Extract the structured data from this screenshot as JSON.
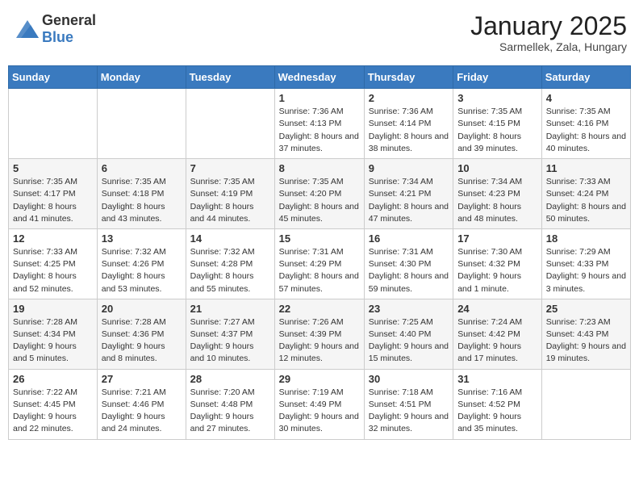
{
  "header": {
    "logo_general": "General",
    "logo_blue": "Blue",
    "month_title": "January 2025",
    "location": "Sarmellek, Zala, Hungary"
  },
  "weekdays": [
    "Sunday",
    "Monday",
    "Tuesday",
    "Wednesday",
    "Thursday",
    "Friday",
    "Saturday"
  ],
  "weeks": [
    [
      {
        "day": "",
        "sunrise": "",
        "sunset": "",
        "daylight": ""
      },
      {
        "day": "",
        "sunrise": "",
        "sunset": "",
        "daylight": ""
      },
      {
        "day": "",
        "sunrise": "",
        "sunset": "",
        "daylight": ""
      },
      {
        "day": "1",
        "sunrise": "Sunrise: 7:36 AM",
        "sunset": "Sunset: 4:13 PM",
        "daylight": "Daylight: 8 hours and 37 minutes."
      },
      {
        "day": "2",
        "sunrise": "Sunrise: 7:36 AM",
        "sunset": "Sunset: 4:14 PM",
        "daylight": "Daylight: 8 hours and 38 minutes."
      },
      {
        "day": "3",
        "sunrise": "Sunrise: 7:35 AM",
        "sunset": "Sunset: 4:15 PM",
        "daylight": "Daylight: 8 hours and 39 minutes."
      },
      {
        "day": "4",
        "sunrise": "Sunrise: 7:35 AM",
        "sunset": "Sunset: 4:16 PM",
        "daylight": "Daylight: 8 hours and 40 minutes."
      }
    ],
    [
      {
        "day": "5",
        "sunrise": "Sunrise: 7:35 AM",
        "sunset": "Sunset: 4:17 PM",
        "daylight": "Daylight: 8 hours and 41 minutes."
      },
      {
        "day": "6",
        "sunrise": "Sunrise: 7:35 AM",
        "sunset": "Sunset: 4:18 PM",
        "daylight": "Daylight: 8 hours and 43 minutes."
      },
      {
        "day": "7",
        "sunrise": "Sunrise: 7:35 AM",
        "sunset": "Sunset: 4:19 PM",
        "daylight": "Daylight: 8 hours and 44 minutes."
      },
      {
        "day": "8",
        "sunrise": "Sunrise: 7:35 AM",
        "sunset": "Sunset: 4:20 PM",
        "daylight": "Daylight: 8 hours and 45 minutes."
      },
      {
        "day": "9",
        "sunrise": "Sunrise: 7:34 AM",
        "sunset": "Sunset: 4:21 PM",
        "daylight": "Daylight: 8 hours and 47 minutes."
      },
      {
        "day": "10",
        "sunrise": "Sunrise: 7:34 AM",
        "sunset": "Sunset: 4:23 PM",
        "daylight": "Daylight: 8 hours and 48 minutes."
      },
      {
        "day": "11",
        "sunrise": "Sunrise: 7:33 AM",
        "sunset": "Sunset: 4:24 PM",
        "daylight": "Daylight: 8 hours and 50 minutes."
      }
    ],
    [
      {
        "day": "12",
        "sunrise": "Sunrise: 7:33 AM",
        "sunset": "Sunset: 4:25 PM",
        "daylight": "Daylight: 8 hours and 52 minutes."
      },
      {
        "day": "13",
        "sunrise": "Sunrise: 7:32 AM",
        "sunset": "Sunset: 4:26 PM",
        "daylight": "Daylight: 8 hours and 53 minutes."
      },
      {
        "day": "14",
        "sunrise": "Sunrise: 7:32 AM",
        "sunset": "Sunset: 4:28 PM",
        "daylight": "Daylight: 8 hours and 55 minutes."
      },
      {
        "day": "15",
        "sunrise": "Sunrise: 7:31 AM",
        "sunset": "Sunset: 4:29 PM",
        "daylight": "Daylight: 8 hours and 57 minutes."
      },
      {
        "day": "16",
        "sunrise": "Sunrise: 7:31 AM",
        "sunset": "Sunset: 4:30 PM",
        "daylight": "Daylight: 8 hours and 59 minutes."
      },
      {
        "day": "17",
        "sunrise": "Sunrise: 7:30 AM",
        "sunset": "Sunset: 4:32 PM",
        "daylight": "Daylight: 9 hours and 1 minute."
      },
      {
        "day": "18",
        "sunrise": "Sunrise: 7:29 AM",
        "sunset": "Sunset: 4:33 PM",
        "daylight": "Daylight: 9 hours and 3 minutes."
      }
    ],
    [
      {
        "day": "19",
        "sunrise": "Sunrise: 7:28 AM",
        "sunset": "Sunset: 4:34 PM",
        "daylight": "Daylight: 9 hours and 5 minutes."
      },
      {
        "day": "20",
        "sunrise": "Sunrise: 7:28 AM",
        "sunset": "Sunset: 4:36 PM",
        "daylight": "Daylight: 9 hours and 8 minutes."
      },
      {
        "day": "21",
        "sunrise": "Sunrise: 7:27 AM",
        "sunset": "Sunset: 4:37 PM",
        "daylight": "Daylight: 9 hours and 10 minutes."
      },
      {
        "day": "22",
        "sunrise": "Sunrise: 7:26 AM",
        "sunset": "Sunset: 4:39 PM",
        "daylight": "Daylight: 9 hours and 12 minutes."
      },
      {
        "day": "23",
        "sunrise": "Sunrise: 7:25 AM",
        "sunset": "Sunset: 4:40 PM",
        "daylight": "Daylight: 9 hours and 15 minutes."
      },
      {
        "day": "24",
        "sunrise": "Sunrise: 7:24 AM",
        "sunset": "Sunset: 4:42 PM",
        "daylight": "Daylight: 9 hours and 17 minutes."
      },
      {
        "day": "25",
        "sunrise": "Sunrise: 7:23 AM",
        "sunset": "Sunset: 4:43 PM",
        "daylight": "Daylight: 9 hours and 19 minutes."
      }
    ],
    [
      {
        "day": "26",
        "sunrise": "Sunrise: 7:22 AM",
        "sunset": "Sunset: 4:45 PM",
        "daylight": "Daylight: 9 hours and 22 minutes."
      },
      {
        "day": "27",
        "sunrise": "Sunrise: 7:21 AM",
        "sunset": "Sunset: 4:46 PM",
        "daylight": "Daylight: 9 hours and 24 minutes."
      },
      {
        "day": "28",
        "sunrise": "Sunrise: 7:20 AM",
        "sunset": "Sunset: 4:48 PM",
        "daylight": "Daylight: 9 hours and 27 minutes."
      },
      {
        "day": "29",
        "sunrise": "Sunrise: 7:19 AM",
        "sunset": "Sunset: 4:49 PM",
        "daylight": "Daylight: 9 hours and 30 minutes."
      },
      {
        "day": "30",
        "sunrise": "Sunrise: 7:18 AM",
        "sunset": "Sunset: 4:51 PM",
        "daylight": "Daylight: 9 hours and 32 minutes."
      },
      {
        "day": "31",
        "sunrise": "Sunrise: 7:16 AM",
        "sunset": "Sunset: 4:52 PM",
        "daylight": "Daylight: 9 hours and 35 minutes."
      },
      {
        "day": "",
        "sunrise": "",
        "sunset": "",
        "daylight": ""
      }
    ]
  ]
}
